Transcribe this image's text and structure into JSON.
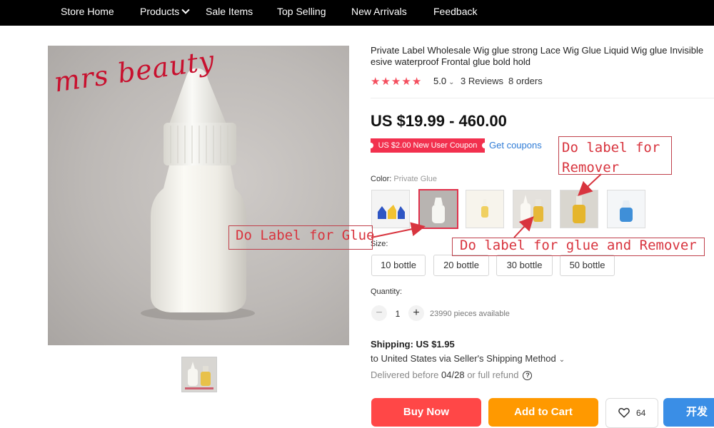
{
  "nav": {
    "items": [
      "Store Home",
      "Products",
      "Sale Items",
      "Top Selling",
      "New Arrivals",
      "Feedback"
    ]
  },
  "gallery": {
    "watermark": "mrs beauty"
  },
  "product": {
    "title_line1": "Private Label Wholesale Wig glue strong Lace Wig Glue Liquid Wig glue Invisible",
    "title_line2": "esive waterproof Frontal glue bold hold",
    "rating": "5.0",
    "reviews": "3 Reviews",
    "orders": "8 orders",
    "price": "US $19.99 - 460.00",
    "coupon": "US $2.00 New User Coupon",
    "get_coupons": "Get coupons",
    "color_label": "Color:",
    "color_value": "Private Glue",
    "size_label": "Size:",
    "sizes": [
      "10 bottle",
      "20 bottle",
      "30 bottle",
      "50 bottle"
    ],
    "quantity_label": "Quantity:",
    "quantity": "1",
    "available": "23990 pieces available",
    "shipping_title": "Shipping: US $1.95",
    "shipping_method": "to United States via Seller's Shipping Method",
    "delivery_prefix": "Delivered before",
    "delivery_date": "04/28",
    "delivery_suffix": "or full refund",
    "buy_now": "Buy Now",
    "add_to_cart": "Add to Cart",
    "wishlist_count": "64",
    "chat": "开发"
  },
  "colors": {
    "accent_red": "#ff4747",
    "cart_orange": "#ff9900",
    "link_blue": "#2e7bd6",
    "annotation_red": "#d8343e"
  },
  "annotations": {
    "remover": [
      "Do label for",
      "Remover"
    ],
    "glue": "Do Label for Glue",
    "glue_remover": "Do label for glue and Remover"
  }
}
